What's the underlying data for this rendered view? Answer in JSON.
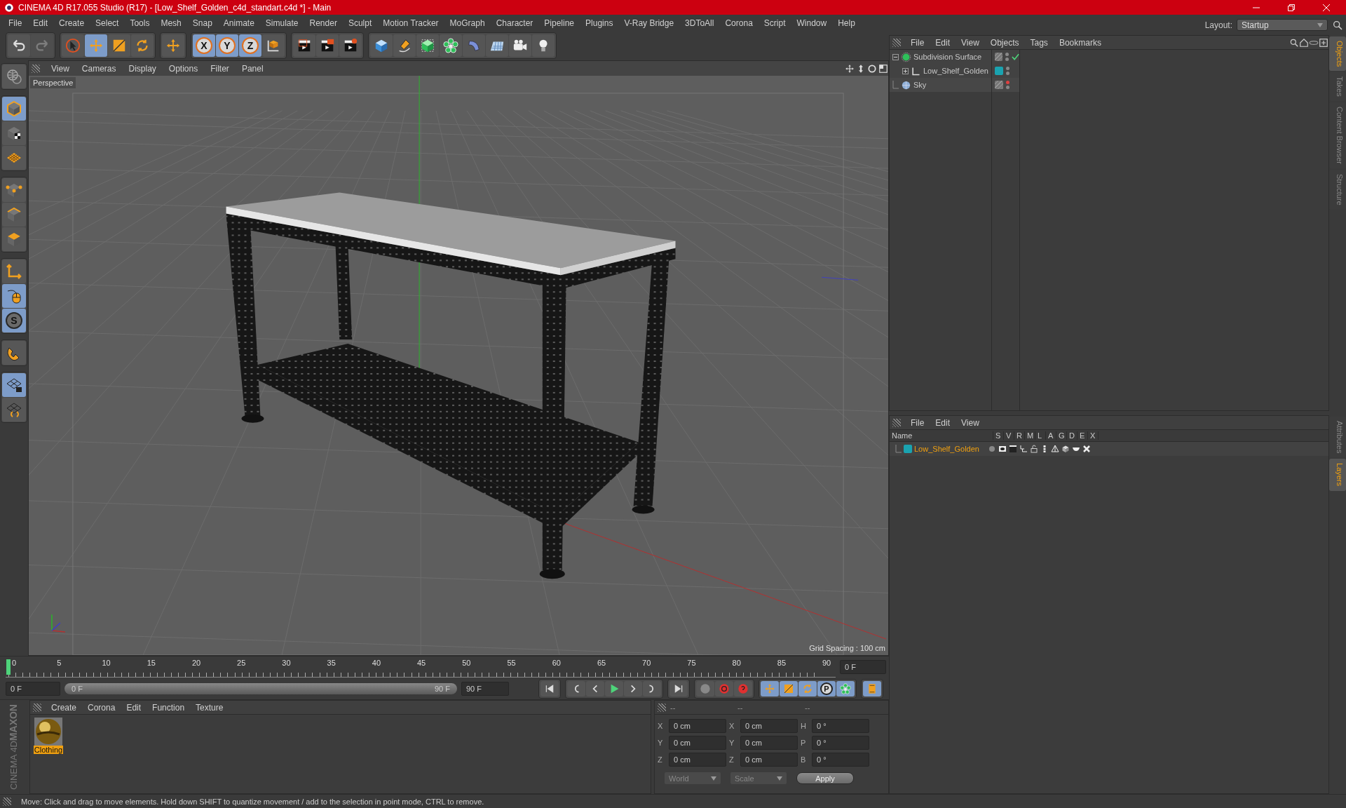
{
  "window": {
    "title": "CINEMA 4D R17.055 Studio (R17) - [Low_Shelf_Golden_c4d_standart.c4d *] - Main"
  },
  "menu": [
    "File",
    "Edit",
    "Create",
    "Select",
    "Tools",
    "Mesh",
    "Snap",
    "Animate",
    "Simulate",
    "Render",
    "Sculpt",
    "Motion Tracker",
    "MoGraph",
    "Character",
    "Pipeline",
    "Plugins",
    "V-Ray Bridge",
    "3DToAll",
    "Corona",
    "Script",
    "Window",
    "Help"
  ],
  "layout": {
    "label": "Layout:",
    "value": "Startup"
  },
  "toolbar_groups": [
    [
      {
        "disabled": false
      },
      {
        "disabled": true
      }
    ],
    [
      {
        "selected": false
      },
      {
        "selected": true
      },
      {
        "selected": false
      },
      {
        "selected": false
      }
    ],
    [
      {
        "selected": false
      }
    ],
    [
      {
        "label": "X",
        "selected": true
      },
      {
        "label": "Y",
        "selected": true
      },
      {
        "label": "Z",
        "selected": true
      },
      {
        "selected": false
      }
    ],
    [
      {
        "selected": false
      },
      {
        "selected": false
      },
      {
        "selected": false
      }
    ],
    [
      {
        "selected": false
      },
      {
        "selected": false
      },
      {
        "selected": false
      },
      {
        "selected": false
      },
      {
        "selected": false
      },
      {
        "selected": false
      },
      {
        "selected": false
      },
      {
        "selected": false
      }
    ]
  ],
  "tool_groups": [
    [
      {
        "selected": false
      }
    ],
    [
      {
        "selected": true
      },
      {
        "selected": false
      },
      {
        "selected": false
      }
    ],
    [
      {
        "selected": false
      },
      {
        "selected": false
      },
      {
        "selected": false
      }
    ],
    [
      {
        "selected": false
      },
      {
        "selected": true
      },
      {
        "label": "S",
        "selected": true
      }
    ],
    [
      {
        "selected": false
      }
    ],
    [
      {
        "selected": true
      },
      {
        "selected": false
      }
    ]
  ],
  "viewport": {
    "menu": [
      "View",
      "Cameras",
      "Display",
      "Options",
      "Filter",
      "Panel"
    ],
    "camera": "Perspective",
    "grid_spacing": "Grid Spacing : 100 cm"
  },
  "timeline": {
    "ticks": [
      "0",
      "5",
      "10",
      "15",
      "20",
      "25",
      "30",
      "35",
      "40",
      "45",
      "50",
      "55",
      "60",
      "65",
      "70",
      "75",
      "80",
      "85",
      "90"
    ],
    "level": 0,
    "current_frame": "0 F",
    "start": "0 F",
    "range": {
      "start": "0 F",
      "end": "90 F",
      "level": 1
    },
    "end": "90 F",
    "key_buttons": [
      {
        "selected": true
      },
      {
        "selected": true
      },
      {
        "selected": true
      },
      {
        "label": "P",
        "selected": true
      },
      {
        "selected": true
      }
    ]
  },
  "materials": {
    "menu": [
      "Create",
      "Corona",
      "Edit",
      "Function",
      "Texture"
    ],
    "items": [
      {
        "name": "Clothing",
        "selected": true
      }
    ]
  },
  "logo": {
    "brand": "MAXON",
    "product": "CINEMA 4D"
  },
  "coordinates": {
    "headers": [
      "--",
      "--",
      "--"
    ],
    "rows": [
      {
        "axis": "X",
        "position": "0 cm",
        "size_axis": "X",
        "size": "0 cm",
        "rot_axis": "H",
        "rotation": "0 °"
      },
      {
        "axis": "Y",
        "position": "0 cm",
        "size_axis": "Y",
        "size": "0 cm",
        "rot_axis": "P",
        "rotation": "0 °"
      },
      {
        "axis": "Z",
        "position": "0 cm",
        "size_axis": "Z",
        "size": "0 cm",
        "rot_axis": "B",
        "rotation": "0 °"
      }
    ],
    "space": "World",
    "mode": "Scale",
    "apply": "Apply"
  },
  "objects": {
    "menu": [
      "File",
      "Edit",
      "View",
      "Objects",
      "Tags",
      "Bookmarks"
    ],
    "items": [
      {
        "name": "Subdivision Surface",
        "kind": "subdivision",
        "expanded": true,
        "check": true,
        "hidden_in_editor": false,
        "children": [
          {
            "name": "Low_Shelf_Golden",
            "kind": "null",
            "expanded": false,
            "check": false,
            "hidden_in_editor": false,
            "color": "#1aa3b0"
          }
        ]
      },
      {
        "name": "Sky",
        "kind": "sky",
        "check": false,
        "hidden_in_editor": true
      }
    ]
  },
  "layers": {
    "menu": [
      "File",
      "Edit",
      "View"
    ],
    "columns": [
      "Name",
      "S",
      "V",
      "R",
      "M",
      "L",
      "A",
      "G",
      "D",
      "E",
      "X"
    ],
    "rows": [
      {
        "name": "Low_Shelf_Golden",
        "color": "#1aa3b0"
      }
    ]
  },
  "side_tabs_top": [
    {
      "label": "Objects",
      "selected": true
    },
    {
      "label": "Takes",
      "selected": false
    },
    {
      "label": "Content Browser",
      "selected": false
    },
    {
      "label": "Structure",
      "selected": false
    }
  ],
  "side_tabs_bottom": [
    {
      "label": "Attributes",
      "selected": false
    },
    {
      "label": "Layers",
      "selected": true
    }
  ],
  "status_bar": "Move: Click and drag to move elements. Hold down SHIFT to quantize movement / add to the selection in point mode, CTRL to remove."
}
